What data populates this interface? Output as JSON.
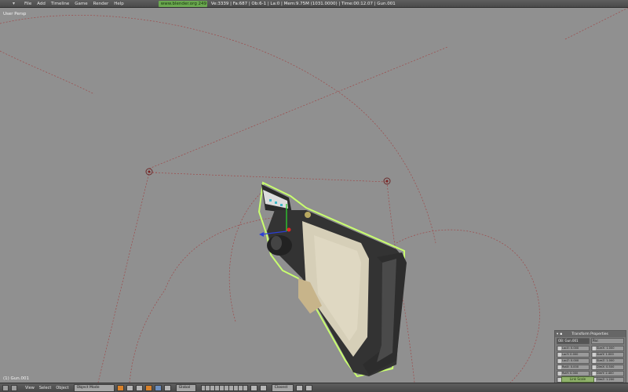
{
  "topbar": {
    "menu": [
      "File",
      "Add",
      "Timeline",
      "Game",
      "Render",
      "Help"
    ],
    "scene_field": "www.blender.org 249",
    "stats": "Ve:3339 | Fa:687 | Ob:6-1 | La:0 | Mem:9.75M (1031.0000) | Time:00:12.07 | Gun.001"
  },
  "viewport": {
    "view_label": "User Persp",
    "object_label": "(1) Gun.001"
  },
  "transform_panel": {
    "title": "Transform Properties",
    "name_field": "OB: Gun.001",
    "parent_field": "Par:",
    "loc": [
      "LocX: 0.000",
      "LocY: 0.000",
      "LocZ: 0.000"
    ],
    "rot": [
      "RotX: 0.000",
      "RotY: 0.000",
      "RotZ: 0.000"
    ],
    "size": [
      "SizeX: 1.000",
      "SizeY: 1.000",
      "SizeZ: 1.000"
    ],
    "dim": [
      "DimX: 0.500",
      "DimY: 2.400",
      "DimZ: 1.200"
    ],
    "link_button": "Link Scale"
  },
  "bottombar": {
    "menu": [
      "View",
      "Select",
      "Object"
    ],
    "mode_select": "Object Mode",
    "pivot_select": "Global",
    "layer_select": "Closest"
  },
  "colors": {
    "topbar": "#4f4f4f",
    "viewport": "#909090",
    "wire": "#a44a4a",
    "selection_outline": "#c8ff6a"
  }
}
